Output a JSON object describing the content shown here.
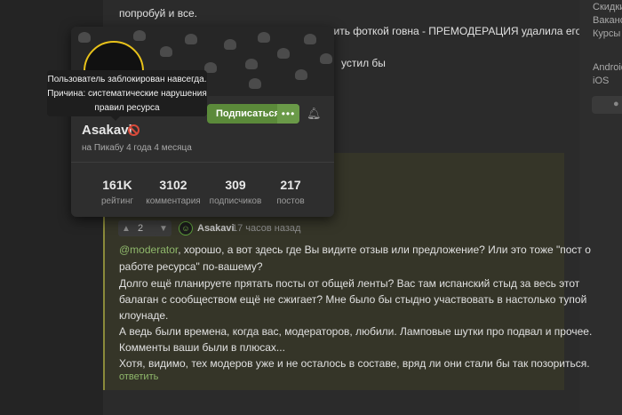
{
  "post": {
    "lines": [
      "попробуй и все.",
      "тить фоткой говна - ПРЕМОДЕРАЦИЯ удалила его",
      "устил бы"
    ]
  },
  "sidebar": {
    "links_top": [
      "Скидки",
      "Ваканс",
      "Курсы"
    ],
    "links_apps": [
      "Android",
      "iOS"
    ]
  },
  "profile_card": {
    "tooltip_lines": [
      "Пользователь заблокирован навсегда.",
      "Причина: систематические нарушения",
      "правил ресурса"
    ],
    "subscribe_label": "Подписаться",
    "more_label": "•••",
    "name": "Asakavi",
    "since": "на Пикабу 4 года 4 месяца",
    "stats": [
      {
        "value": "161K",
        "label": "рейтинг"
      },
      {
        "value": "3102",
        "label": "комментария"
      },
      {
        "value": "309",
        "label": "подписчиков"
      },
      {
        "value": "217",
        "label": "постов"
      }
    ]
  },
  "comment": {
    "votes": "2",
    "author": "Asakavi",
    "time": "17 часов назад",
    "mention": "@moderator",
    "lines": [
      ", хорошо, а вот здесь где Вы видите отзыв или предложение? Или это тоже \"пост о",
      "работе ресурса\" по-вашему?",
      "Долго ещё планируете прятать посты от общей ленты? Вас там испанский стыд за весь этот",
      "балаган с сообществом ещё не сжигает? Мне было бы стыдно участвовать в настолько тупой",
      "клоунаде.",
      "А ведь были времена, когда вас, модераторов, любили. Ламповые шутки про подвал и прочее.",
      "Комменты ваши были в плюсах...",
      "Хотя, видимо, тех модеров уже и не осталось в составе, вряд ли они стали бы так позориться."
    ],
    "reply_label": "ответить"
  }
}
